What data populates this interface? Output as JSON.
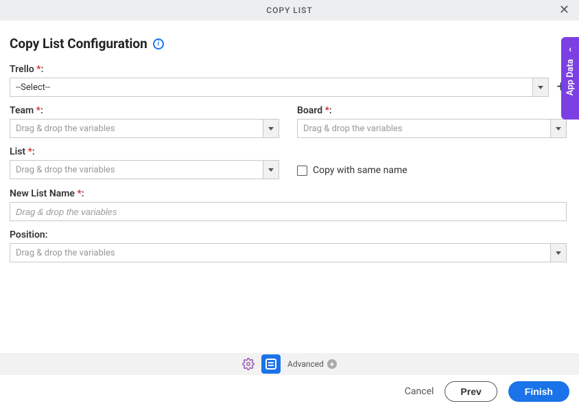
{
  "header": {
    "title": "COPY LIST"
  },
  "page": {
    "title": "Copy List Configuration"
  },
  "fields": {
    "trello": {
      "label": "Trello",
      "required": true,
      "value": "--Select--"
    },
    "team": {
      "label": "Team",
      "required": true,
      "placeholder": "Drag & drop the variables"
    },
    "board": {
      "label": "Board",
      "required": true,
      "placeholder": "Drag & drop the variables"
    },
    "list": {
      "label": "List",
      "required": true,
      "placeholder": "Drag & drop the variables"
    },
    "copy_same": {
      "label": "Copy with same name",
      "checked": false
    },
    "new_list_name": {
      "label": "New List Name",
      "required": true,
      "placeholder": "Drag & drop the variables"
    },
    "position": {
      "label": "Position",
      "required": false,
      "placeholder": "Drag & drop the variables"
    }
  },
  "side_tab": {
    "label": "App Data"
  },
  "toolbar": {
    "advanced_label": "Advanced"
  },
  "footer": {
    "cancel": "Cancel",
    "prev": "Prev",
    "finish": "Finish"
  }
}
